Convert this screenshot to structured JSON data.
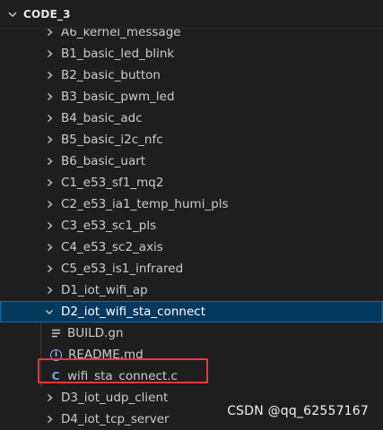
{
  "explorer": {
    "root_label": "CODE_3"
  },
  "tree": {
    "items": [
      {
        "type": "folder",
        "label": "A6_kernel_message",
        "expanded": false
      },
      {
        "type": "folder",
        "label": "B1_basic_led_blink",
        "expanded": false
      },
      {
        "type": "folder",
        "label": "B2_basic_button",
        "expanded": false
      },
      {
        "type": "folder",
        "label": "B3_basic_pwm_led",
        "expanded": false
      },
      {
        "type": "folder",
        "label": "B4_basic_adc",
        "expanded": false
      },
      {
        "type": "folder",
        "label": "B5_basic_i2c_nfc",
        "expanded": false
      },
      {
        "type": "folder",
        "label": "B6_basic_uart",
        "expanded": false
      },
      {
        "type": "folder",
        "label": "C1_e53_sf1_mq2",
        "expanded": false
      },
      {
        "type": "folder",
        "label": "C2_e53_ia1_temp_humi_pls",
        "expanded": false
      },
      {
        "type": "folder",
        "label": "C3_e53_sc1_pls",
        "expanded": false
      },
      {
        "type": "folder",
        "label": "C4_e53_sc2_axis",
        "expanded": false
      },
      {
        "type": "folder",
        "label": "C5_e53_is1_infrared",
        "expanded": false
      },
      {
        "type": "folder",
        "label": "D1_iot_wifi_ap",
        "expanded": false
      },
      {
        "type": "folder",
        "label": "D2_iot_wifi_sta_connect",
        "expanded": true,
        "selected": true
      },
      {
        "type": "file",
        "label": "BUILD.gn",
        "icon": "lines-icon"
      },
      {
        "type": "file",
        "label": "README.md",
        "icon": "info-icon"
      },
      {
        "type": "file",
        "label": "wifi_sta_connect.c",
        "icon": "c-file-icon",
        "highlighted": true
      },
      {
        "type": "folder",
        "label": "D3_iot_udp_client",
        "expanded": false
      },
      {
        "type": "folder",
        "label": "D4_iot_tcp_server",
        "expanded": false
      }
    ]
  },
  "watermark": "CSDN @qq_62557167",
  "colors": {
    "background": "#1e1e1e",
    "selected_background": "#04395e",
    "highlight_box": "#e53935",
    "c_icon": "#6fa8dc"
  }
}
